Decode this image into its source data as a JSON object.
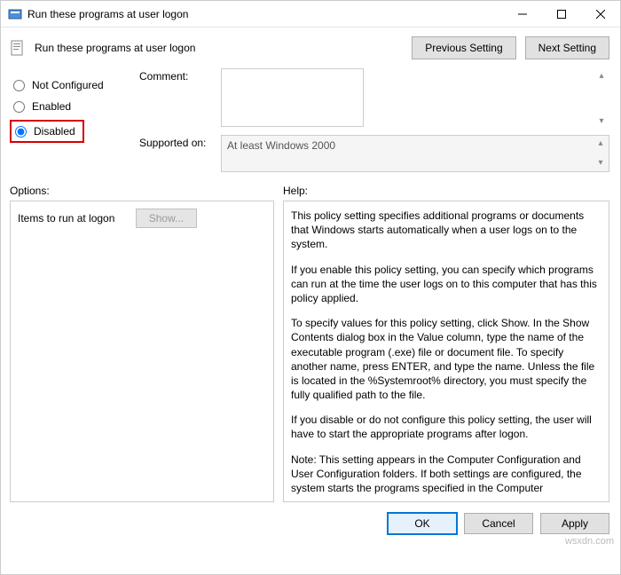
{
  "window": {
    "title": "Run these programs at user logon"
  },
  "header": {
    "title": "Run these programs at user logon",
    "prev_label": "Previous Setting",
    "next_label": "Next Setting"
  },
  "radios": {
    "not_configured": "Not Configured",
    "enabled": "Enabled",
    "disabled": "Disabled",
    "selected": "disabled"
  },
  "fields": {
    "comment_label": "Comment:",
    "comment_value": "",
    "supported_label": "Supported on:",
    "supported_value": "At least Windows 2000"
  },
  "sections": {
    "options_label": "Options:",
    "help_label": "Help:"
  },
  "options": {
    "items_label": "Items to run at logon",
    "show_label": "Show..."
  },
  "help": {
    "p1": "This policy setting specifies additional programs or documents that Windows starts automatically when a user logs on to the system.",
    "p2": "If you enable this policy setting, you can specify which programs can run at the time the user logs on to this computer that has this policy applied.",
    "p3": "To specify values for this policy setting, click Show. In the Show Contents dialog box in the Value column, type the name of the executable program (.exe) file or document file. To specify another name, press ENTER, and type the name. Unless the file is located in the %Systemroot% directory, you must specify the fully qualified path to the file.",
    "p4": "If you disable or do not configure this policy setting, the user will have to start the appropriate programs after logon.",
    "p5": "Note: This setting appears in the Computer Configuration and User Configuration folders. If both settings are configured, the system starts the programs specified in the Computer"
  },
  "footer": {
    "ok": "OK",
    "cancel": "Cancel",
    "apply": "Apply"
  },
  "watermark": "wsxdn.com"
}
